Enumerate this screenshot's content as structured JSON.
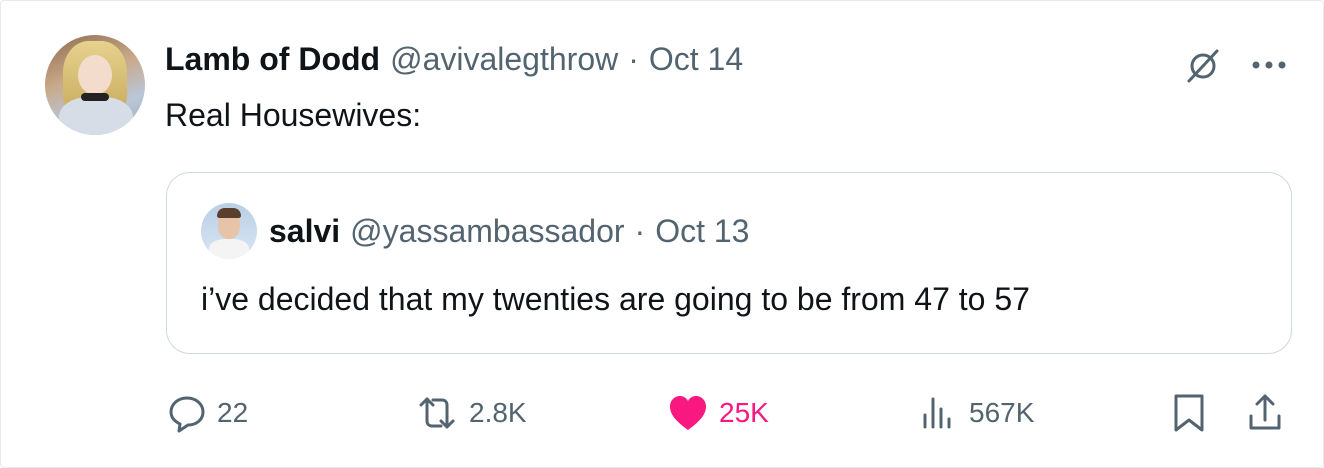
{
  "post": {
    "display_name": "Lamb of Dodd",
    "handle": "@avivalegthrow",
    "separator": "·",
    "date": "Oct 14",
    "text": "Real Housewives:"
  },
  "quoted_post": {
    "display_name": "salvi",
    "handle": "@yassambassador",
    "separator": "·",
    "date": "Oct 13",
    "text": "i’ve decided that my twenties are going to be from 47 to 57"
  },
  "actions": {
    "replies": "22",
    "reposts": "2.8K",
    "likes": "25K",
    "views": "567K"
  },
  "icons": {
    "grok": "grok-icon",
    "more": "more-icon",
    "reply": "reply-icon",
    "repost": "repost-icon",
    "like": "heart-icon",
    "views": "views-icon",
    "bookmark": "bookmark-icon",
    "share": "share-icon"
  },
  "colors": {
    "text": "#0f1419",
    "muted": "#536471",
    "like": "#f91880",
    "border": "#cfd9de"
  }
}
